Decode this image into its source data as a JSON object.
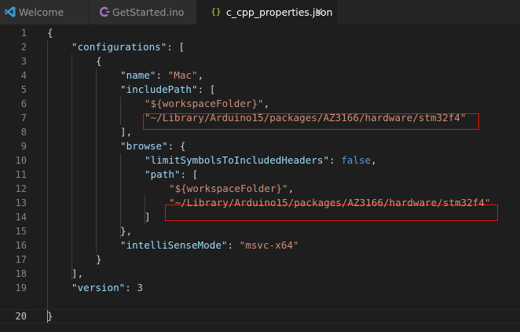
{
  "tabs": [
    {
      "label": "Welcome",
      "icon": "vscode-icon"
    },
    {
      "label": "GetStarted.ino",
      "icon": "arduino-file-icon"
    },
    {
      "label": "c_cpp_properties.json",
      "icon": "json-braces-icon",
      "close": "×"
    }
  ],
  "colors": {
    "key": "#9cdcfe",
    "string": "#ce9178",
    "keyword": "#569cd6",
    "number": "#b5cea8",
    "highlight_box": "#e51400"
  },
  "line_numbers": [
    "1",
    "2",
    "3",
    "4",
    "5",
    "6",
    "7",
    "8",
    "9",
    "10",
    "11",
    "12",
    "13",
    "14",
    "15",
    "16",
    "17",
    "18",
    "19",
    "20"
  ],
  "code": {
    "l1": {
      "brace": "{"
    },
    "l2": {
      "key": "\"configurations\"",
      "rest": ": ["
    },
    "l3": {
      "brace": "{"
    },
    "l4": {
      "key": "\"name\"",
      "colon": ": ",
      "value": "\"Mac\"",
      "tail": ","
    },
    "l5": {
      "key": "\"includePath\"",
      "rest": ": ["
    },
    "l6": {
      "value": "\"${workspaceFolder}\"",
      "tail": ","
    },
    "l7": {
      "value": "\"~/Library/Arduino15/packages/AZ3166/hardware/stm32f4\""
    },
    "l8": {
      "text": "],"
    },
    "l9": {
      "key": "\"browse\"",
      "rest": ": {"
    },
    "l10": {
      "key": "\"limitSymbolsToIncludedHeaders\"",
      "colon": ": ",
      "value": "false",
      "tail": ","
    },
    "l11": {
      "key": "\"path\"",
      "rest": ": ["
    },
    "l12": {
      "value": "\"${workspaceFolder}\"",
      "tail": ","
    },
    "l13": {
      "value": "\"~/Library/Arduino15/packages/AZ3166/hardware/stm32f4\""
    },
    "l14": {
      "text": "]"
    },
    "l15": {
      "text": "},"
    },
    "l16": {
      "key": "\"intelliSenseMode\"",
      "colon": ": ",
      "value": "\"msvc-x64\""
    },
    "l17": {
      "text": "}"
    },
    "l18": {
      "text": "],"
    },
    "l19": {
      "key": "\"version\"",
      "colon": ": ",
      "value": "3"
    },
    "l20": {
      "brace": "}"
    }
  }
}
